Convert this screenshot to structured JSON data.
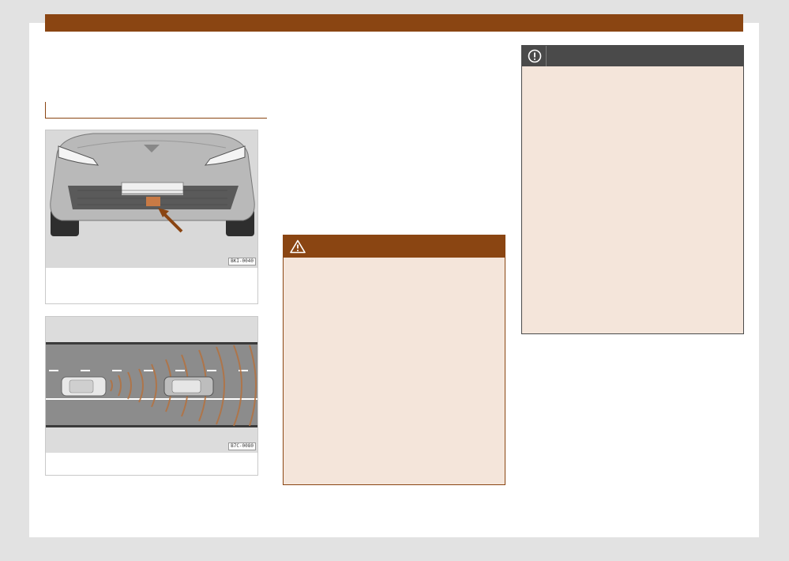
{
  "figures": [
    {
      "code": "BKI-0040"
    },
    {
      "code": "B7C-0080"
    }
  ],
  "colors": {
    "accent": "#8a4512",
    "callout_bg": "#f4e5da",
    "notice_header": "#4a4a4a"
  },
  "icons": {
    "warning": "warning-triangle-icon",
    "notice": "exclamation-circle-icon"
  }
}
